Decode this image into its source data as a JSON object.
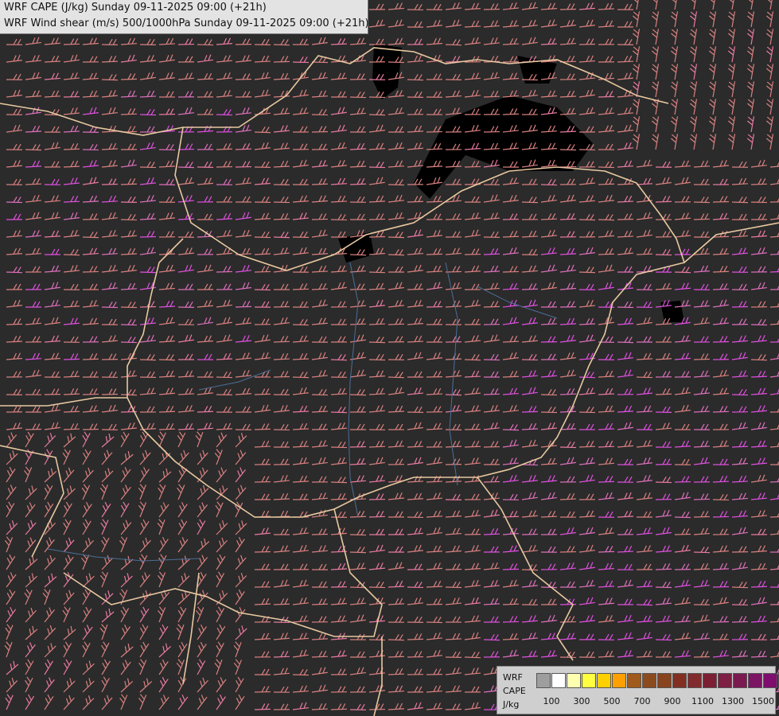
{
  "header": {
    "line1": "WRF CAPE (J/kg) Sunday 09-11-2025 09:00 (+21h)",
    "line2": "WRF Wind shear (m/s) 500/1000hPa Sunday 09-11-2025 09:00 (+21h)"
  },
  "legend": {
    "label_1": "WRF",
    "label_2": "CAPE",
    "label_3": "J/kg",
    "swatch_colors": [
      "#9e9e9e",
      "#ffffff",
      "#ffffb0",
      "#ffff40",
      "#ffd000",
      "#ffa000",
      "#a05a1c",
      "#8c4b1f",
      "#87441f",
      "#822f22",
      "#822b2e",
      "#7c1f34",
      "#7e1f44",
      "#7a1a50",
      "#7c1464",
      "#7e0d6e",
      "#880078"
    ],
    "tick_labels": [
      "100",
      "300",
      "500",
      "700",
      "900",
      "1100",
      "1300",
      "1500"
    ]
  },
  "map": {
    "background": "#2b2b2b",
    "barb_colors": [
      "#d98080",
      "#dd70bb",
      "#e050e0",
      "#e87aa0"
    ],
    "border_color": "#e8c8a0",
    "river_color": "#4a6f99",
    "high_cape_color": "#000000"
  }
}
